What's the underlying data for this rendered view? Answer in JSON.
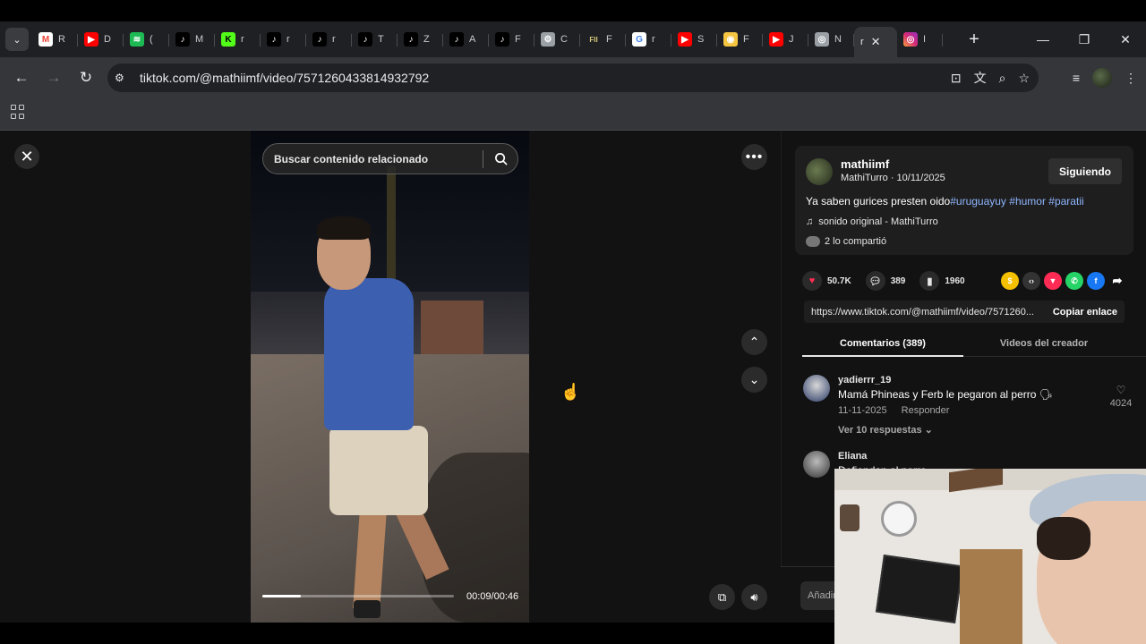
{
  "browser": {
    "tabs": [
      {
        "icon": "gmail-icon",
        "label": "R",
        "color": "#ea4335"
      },
      {
        "icon": "youtube-icon",
        "label": "D",
        "color": "#ff0000"
      },
      {
        "icon": "spotify-icon",
        "label": "(",
        "color": "#1db954"
      },
      {
        "icon": "tiktok-icon",
        "label": "M",
        "color": "#000000"
      },
      {
        "icon": "kick-icon",
        "label": "r",
        "color": "#53fc18"
      },
      {
        "icon": "tiktok-icon",
        "label": "r",
        "color": "#000000"
      },
      {
        "icon": "tiktok-icon",
        "label": "r",
        "color": "#000000"
      },
      {
        "icon": "tiktok-icon",
        "label": "T",
        "color": "#000000"
      },
      {
        "icon": "tiktok-icon",
        "label": "Z",
        "color": "#000000"
      },
      {
        "icon": "tiktok-icon",
        "label": "A",
        "color": "#000000"
      },
      {
        "icon": "tiktok-icon",
        "label": "F",
        "color": "#000000"
      },
      {
        "icon": "settings-icon",
        "label": "C",
        "color": "#9aa0a6"
      },
      {
        "icon": "fii-icon",
        "label": "F",
        "color": "#1f2023"
      },
      {
        "icon": "google-icon",
        "label": "r",
        "color": "#ffffff"
      },
      {
        "icon": "youtube-icon",
        "label": "S",
        "color": "#ff0000"
      },
      {
        "icon": "egg-icon",
        "label": "F",
        "color": "#f5c542"
      },
      {
        "icon": "youtube-icon",
        "label": "J",
        "color": "#ff0000"
      },
      {
        "icon": "chrome-icon",
        "label": "N",
        "color": "#9aa0a6"
      }
    ],
    "active_tab": {
      "label": "r"
    },
    "after_tab": {
      "icon": "instagram-icon",
      "label": "I"
    },
    "url": "tiktok.com/@mathiimf/video/7571260433814932792"
  },
  "video": {
    "search_placeholder": "Buscar contenido relacionado",
    "timecode": "00:09/00:46",
    "progress": 0.2
  },
  "post": {
    "username": "mathiimf",
    "subline": "MathiTurro · 10/11/2025",
    "follow_label": "Siguiendo",
    "description": "Ya saben gurices presten oido",
    "hashtags": "#uruguayuy #humor #paratii",
    "music": "sonido original - MathiTurro",
    "shared": "2 lo compartió",
    "likes": "50.7K",
    "comments": "389",
    "saves": "1960",
    "link": "https://www.tiktok.com/@mathiimf/video/7571260...",
    "copy_label": "Copiar enlace",
    "tab_comments": "Comentarios (389)",
    "tab_videos": "Videos del creador"
  },
  "comments": [
    {
      "name": "yadierrr_19",
      "text": "Mamá Phineas y Ferb le pegaron al perro 🗣",
      "date": "11-11-2025",
      "reply": "Responder",
      "likes": "4024",
      "replies": "Ver 10 respuestas"
    },
    {
      "name": "Eliana",
      "text": "Defiendan al perro"
    }
  ],
  "add_comment": "Añadir"
}
